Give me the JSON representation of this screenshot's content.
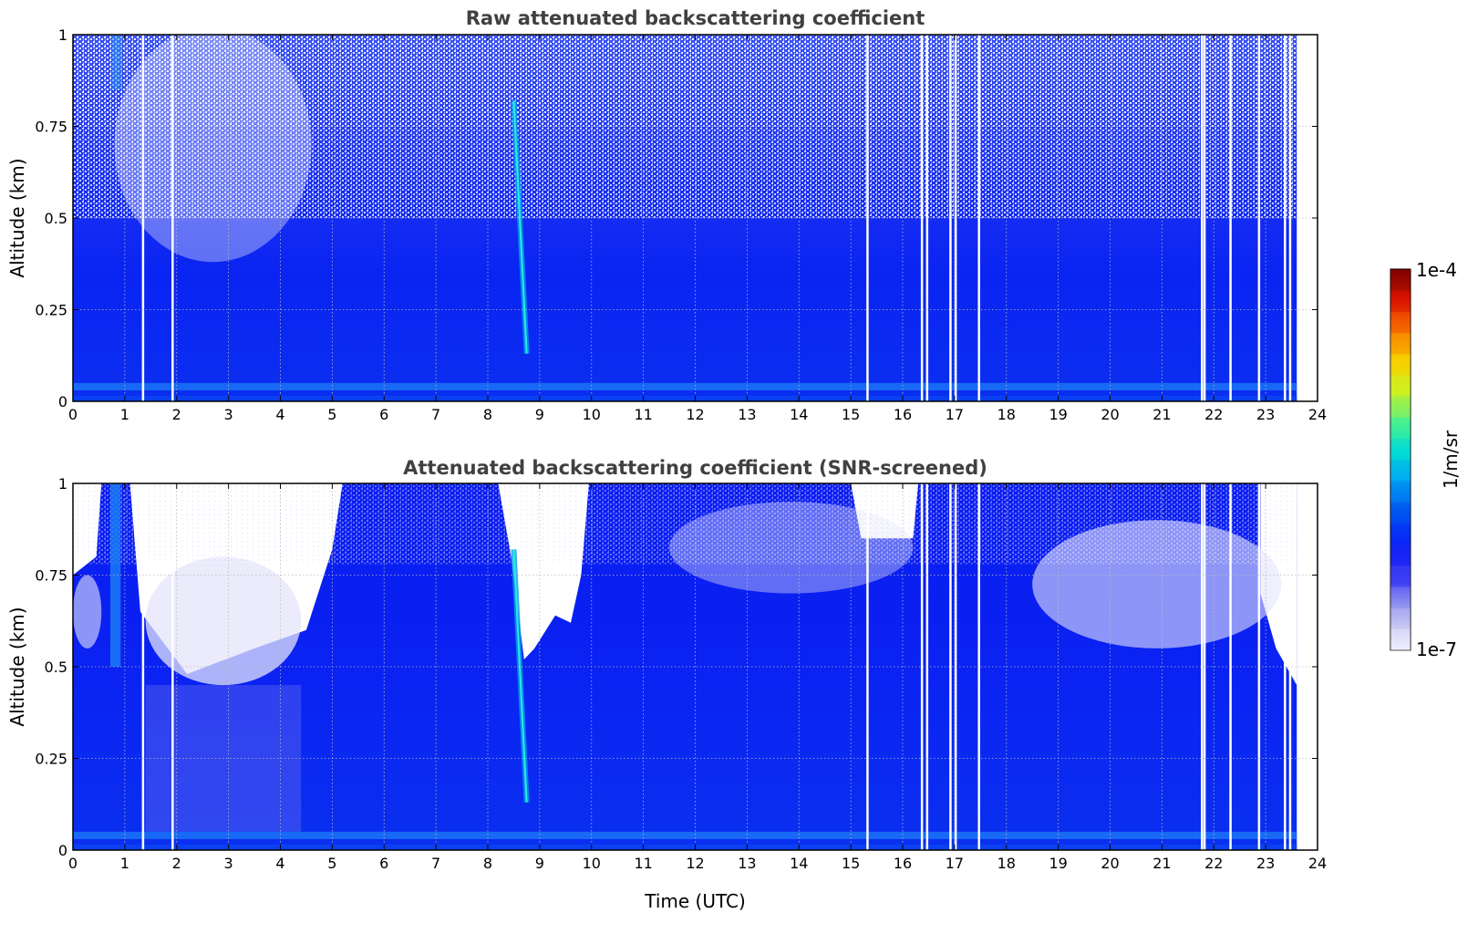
{
  "chart_data": [
    {
      "type": "heatmap",
      "title": "Raw attenuated backscattering coefficient",
      "xlabel": "",
      "ylabel": "Altitude (km)",
      "xlim": [
        0,
        24
      ],
      "ylim": [
        0,
        1
      ],
      "x_ticks": [
        "0",
        "1",
        "2",
        "3",
        "4",
        "5",
        "6",
        "7",
        "8",
        "9",
        "10",
        "11",
        "12",
        "13",
        "14",
        "15",
        "16",
        "17",
        "18",
        "19",
        "20",
        "21",
        "22",
        "23",
        "24"
      ],
      "y_ticks": [
        "0",
        "0.25",
        "0.5",
        "0.75",
        "1"
      ],
      "grid": true,
      "data_end_time": 23.6,
      "gap_times": [
        1.33,
        1.9,
        15.3,
        16.35,
        16.45,
        16.9,
        17.0,
        17.45,
        21.75,
        21.8,
        22.3,
        22.85,
        23.35,
        23.45
      ],
      "features": [
        {
          "label": "falling streak",
          "time_top": 8.5,
          "altitude_top": 0.82,
          "time_bottom": 8.75,
          "altitude_bottom": 0.13
        }
      ]
    },
    {
      "type": "heatmap",
      "title": "Attenuated backscattering coefficient (SNR-screened)",
      "xlabel": "Time (UTC)",
      "ylabel": "Altitude (km)",
      "xlim": [
        0,
        24
      ],
      "ylim": [
        0,
        1
      ],
      "x_ticks": [
        "0",
        "1",
        "2",
        "3",
        "4",
        "5",
        "6",
        "7",
        "8",
        "9",
        "10",
        "11",
        "12",
        "13",
        "14",
        "15",
        "16",
        "17",
        "18",
        "19",
        "20",
        "21",
        "22",
        "23",
        "24"
      ],
      "y_ticks": [
        "0",
        "0.25",
        "0.5",
        "0.75",
        "1"
      ],
      "grid": true,
      "data_end_time": 23.6,
      "gap_times": [
        1.33,
        1.9,
        15.3,
        16.35,
        16.45,
        16.9,
        17.0,
        17.45,
        21.75,
        21.8,
        22.3,
        22.85,
        23.35,
        23.45
      ],
      "features": [
        {
          "label": "falling streak",
          "time_top": 8.5,
          "altitude_top": 0.82,
          "time_bottom": 8.75,
          "altitude_bottom": 0.13
        },
        {
          "label": "screened region",
          "time_start": 8.2,
          "time_end": 9.95,
          "altitude_floor": 0.52
        }
      ]
    }
  ],
  "colorbar": {
    "label": "1/m/sr",
    "max_label": "1e-4",
    "min_label": "1e-7",
    "scale": "log",
    "colors": [
      "#eeeefc",
      "#c8c8f4",
      "#9a9af0",
      "#5a5af0",
      "#2a2af5",
      "#0a1ef5",
      "#0040f0",
      "#0070f0",
      "#00a8f0",
      "#00d8e0",
      "#20f0b0",
      "#80f060",
      "#d0f020",
      "#f8d000",
      "#f89000",
      "#f04000",
      "#d00000",
      "#800000"
    ]
  }
}
